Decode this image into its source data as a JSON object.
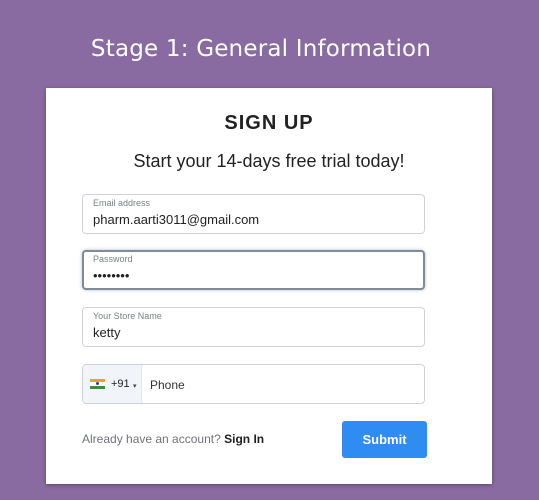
{
  "header": {
    "stage_title": "Stage 1: General Information"
  },
  "form": {
    "title": "SIGN UP",
    "subtitle": "Start your 14-days free trial today!",
    "email": {
      "label": "Email address",
      "value": "pharm.aarti3011@gmail.com"
    },
    "password": {
      "label": "Password",
      "value": "••••••••"
    },
    "store": {
      "label": "Your Store Name",
      "value": "ketty"
    },
    "phone": {
      "country_flag_icon": "india-flag-icon",
      "dial_code": "+91",
      "caret": "▾",
      "placeholder": "Phone"
    },
    "account_prompt": "Already have an account?",
    "signin_label": "Sign In",
    "submit_label": "Submit"
  },
  "colors": {
    "background": "#8a6ba1",
    "accent": "#2f8cf3"
  }
}
